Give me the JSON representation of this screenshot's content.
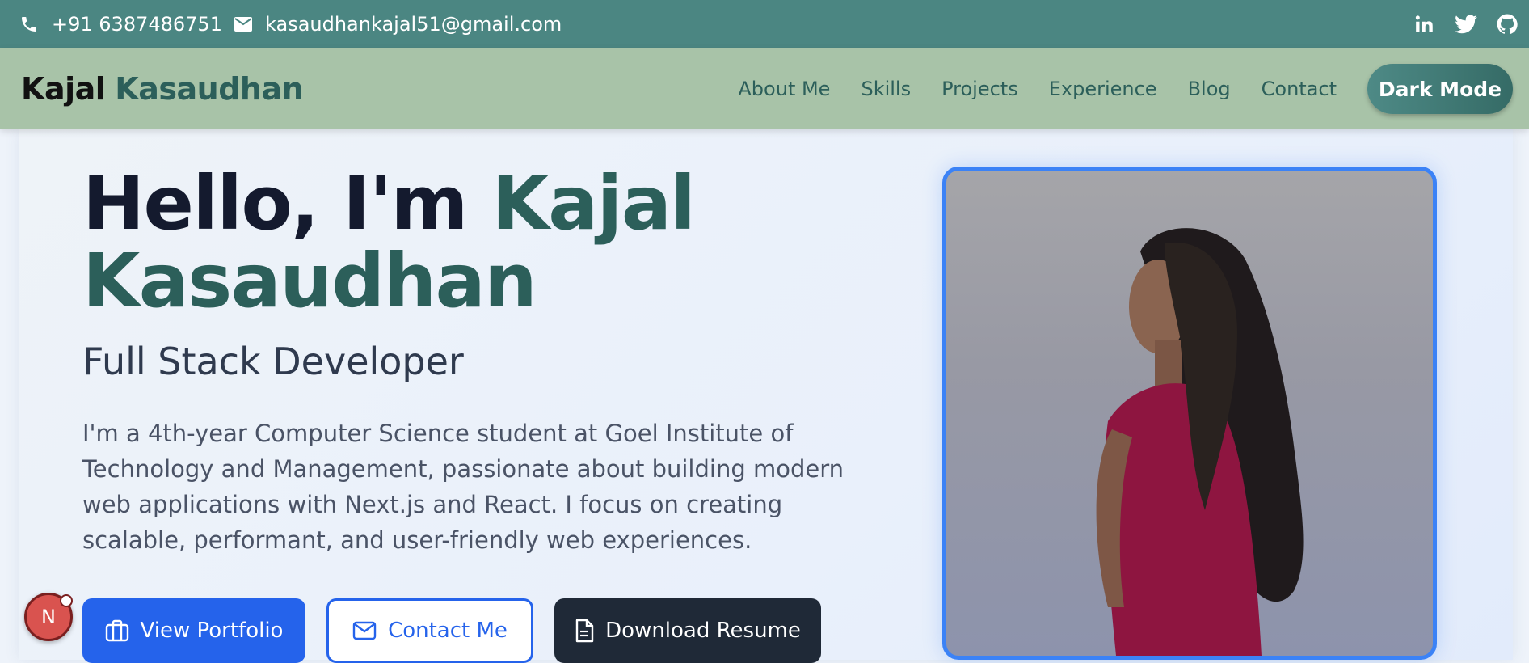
{
  "topbar": {
    "phone": "+91 6387486751",
    "email": "kasaudhankajal51@gmail.com",
    "socials": [
      "linkedin-icon",
      "twitter-icon",
      "github-icon"
    ]
  },
  "navbar": {
    "brand_first": "Kajal",
    "brand_last": "Kasaudhan",
    "links": [
      "About Me",
      "Skills",
      "Projects",
      "Experience",
      "Blog",
      "Contact"
    ],
    "dark_mode_label": "Dark Mode"
  },
  "hero": {
    "greeting": "Hello, I'm",
    "name_line1": "Kajal",
    "name_line2": "Kasaudhan",
    "subtitle": "Full Stack Developer",
    "description": "I'm a 4th-year Computer Science student at Goel Institute of Technology and Management, passionate about building modern web applications with Next.js and React. I focus on creating scalable, performant, and user-friendly web experiences.",
    "buttons": {
      "portfolio": "View Portfolio",
      "contact": "Contact Me",
      "resume": "Download Resume"
    }
  },
  "badge": {
    "letter": "N"
  },
  "colors": {
    "topbar": "#4b8682",
    "navbar": "#a8c3a8",
    "accent": "#2c5f5a",
    "primary": "#2563eb",
    "dark": "#1f2937"
  }
}
